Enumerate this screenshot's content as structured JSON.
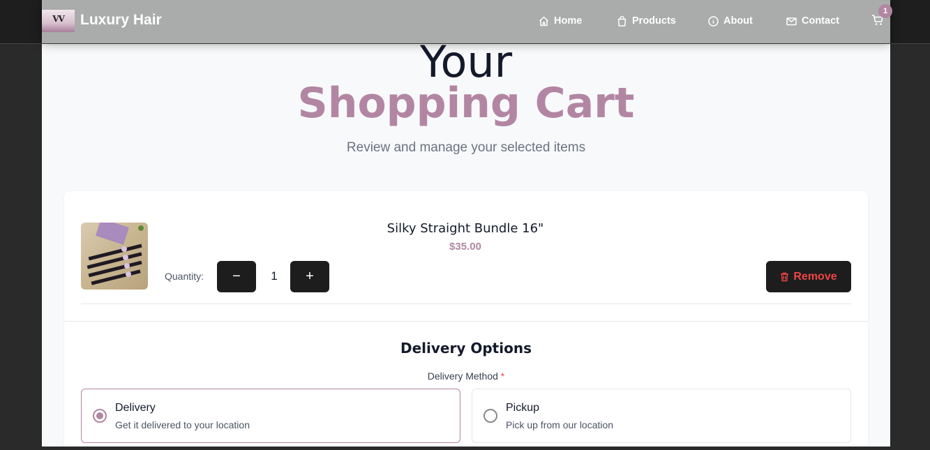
{
  "nav": {
    "logo_text": "VV",
    "brand": "Luxury Hair",
    "links": [
      {
        "label": "Home",
        "icon": "home-icon"
      },
      {
        "label": "Products",
        "icon": "shopping-bag-icon"
      },
      {
        "label": "About",
        "icon": "info-icon"
      },
      {
        "label": "Contact",
        "icon": "mail-icon"
      }
    ],
    "cart_count": "1"
  },
  "header": {
    "title_line1": "Your",
    "title_line2": "Shopping Cart",
    "subtitle": "Review and manage your selected items"
  },
  "cart": {
    "items": [
      {
        "name": "Silky Straight Bundle 16\"",
        "price": "$35.00",
        "quantity_label": "Quantity:",
        "quantity": "1",
        "remove_label": "Remove"
      }
    ]
  },
  "delivery": {
    "title": "Delivery Options",
    "method_label": "Delivery Method",
    "required_mark": "*",
    "options": [
      {
        "title": "Delivery",
        "description": "Get it delivered to your location",
        "selected": true
      },
      {
        "title": "Pickup",
        "description": "Pick up from our location",
        "selected": false
      }
    ]
  },
  "colors": {
    "accent": "#b286a3",
    "danger": "#ef4444",
    "dark_button": "#1d1d1d"
  }
}
